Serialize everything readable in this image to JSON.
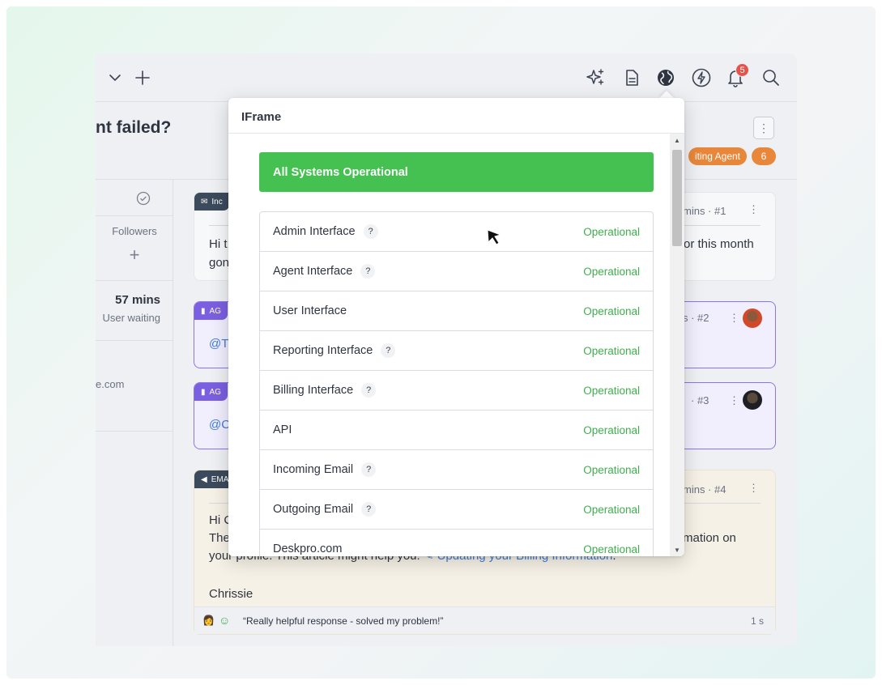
{
  "topbar": {
    "icons": [
      "chevron-down-icon",
      "plus-icon",
      "sparkle-icon",
      "document-icon",
      "globe-icon",
      "lightning-icon",
      "bell-icon",
      "search-icon"
    ],
    "notification_count": "5"
  },
  "ticket": {
    "title": "nt failed?",
    "status_label": "iting Agent",
    "count": "6"
  },
  "sidebar": {
    "followers_label": "Followers",
    "wait_time": "57 mins",
    "wait_label": "User waiting",
    "email_fragment": "e.com"
  },
  "messages": [
    {
      "tag": "Inc",
      "meta": "mins · #1",
      "line1": "Hi t",
      "line1_end": "or this month",
      "line2": "gon"
    },
    {
      "tag": "AG",
      "meta": "s · #2",
      "text": "@Tl"
    },
    {
      "tag": "AG",
      "meta": "· #3",
      "text": "@C"
    },
    {
      "tag": "EMA",
      "meta": "mins · #4",
      "greeting": "Hi C",
      "line2": "The",
      "line2_end": "mation on",
      "line3_start": "your profile. This article might help you: ",
      "line3_link": "Updating your Billing Information",
      "line3_end": ".",
      "signature": "Chrissie",
      "feedback": "“Really helpful response - solved my problem!”",
      "feedback_time": "1 s"
    }
  ],
  "popup": {
    "title": "IFrame",
    "banner": "All Systems Operational",
    "components": [
      {
        "name": "Admin Interface",
        "help": "?",
        "status": "Operational"
      },
      {
        "name": "Agent Interface",
        "help": "?",
        "status": "Operational"
      },
      {
        "name": "User Interface",
        "help": "",
        "status": "Operational"
      },
      {
        "name": "Reporting Interface",
        "help": "?",
        "status": "Operational"
      },
      {
        "name": "Billing Interface",
        "help": "?",
        "status": "Operational"
      },
      {
        "name": "API",
        "help": "",
        "status": "Operational"
      },
      {
        "name": "Incoming Email",
        "help": "?",
        "status": "Operational"
      },
      {
        "name": "Outgoing Email",
        "help": "?",
        "status": "Operational"
      },
      {
        "name": "Deskpro.com",
        "help": "",
        "status": "Operational"
      }
    ]
  },
  "colors": {
    "operational_green": "#45c152",
    "status_text_green": "#3fae4d",
    "pill_orange": "#e8873a",
    "note_purple": "#8b76e8",
    "badge_red": "#e5534b"
  }
}
